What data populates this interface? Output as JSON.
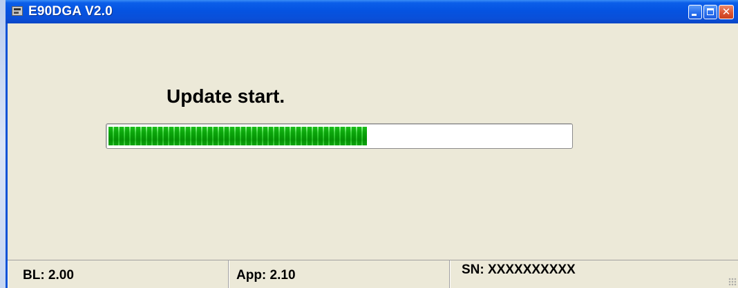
{
  "window": {
    "title": "E90DGA V2.0",
    "app_icon": "app-icon",
    "controls": {
      "minimize_icon": "minimize-icon",
      "maximize_icon": "maximize-icon",
      "close_icon": "close-icon",
      "close_glyph": "✕"
    }
  },
  "main": {
    "status_message": "Update start.",
    "progress": {
      "fraction": 0.56,
      "color": "#2bc72b"
    }
  },
  "statusbar": {
    "bl": "BL: 2.00",
    "app": "App: 2.10",
    "sn": "SN: XXXXXXXXXX"
  },
  "colors": {
    "titlebar": "#0553e1",
    "client_bg": "#ece9d8",
    "close_button": "#dd5433"
  }
}
